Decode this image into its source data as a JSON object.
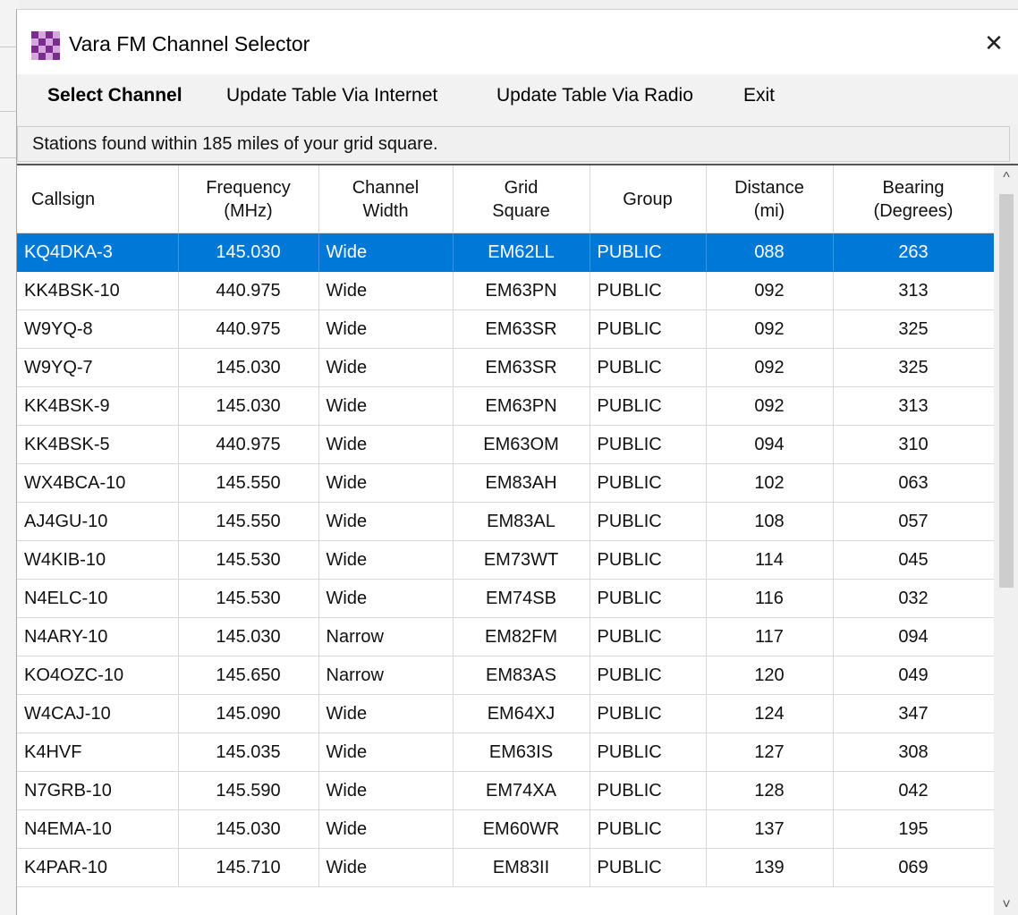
{
  "window": {
    "title": "Vara FM Channel Selector",
    "close_glyph": "✕"
  },
  "menu": {
    "select_channel": "Select Channel",
    "update_internet": "Update Table Via Internet",
    "update_radio": "Update Table Via Radio",
    "exit": "Exit"
  },
  "status": {
    "text": "Stations found within 185 miles of your grid square."
  },
  "table": {
    "headers": {
      "callsign": "Callsign",
      "frequency_1": "Frequency",
      "frequency_2": "(MHz)",
      "width_1": "Channel",
      "width_2": "Width",
      "grid_1": "Grid",
      "grid_2": "Square",
      "group": "Group",
      "distance_1": "Distance",
      "distance_2": "(mi)",
      "bearing_1": "Bearing",
      "bearing_2": "(Degrees)"
    },
    "rows": [
      [
        "KQ4DKA-3",
        "145.030",
        "Wide",
        "EM62LL",
        "PUBLIC",
        "088",
        "263"
      ],
      [
        "KK4BSK-10",
        "440.975",
        "Wide",
        "EM63PN",
        "PUBLIC",
        "092",
        "313"
      ],
      [
        "W9YQ-8",
        "440.975",
        "Wide",
        "EM63SR",
        "PUBLIC",
        "092",
        "325"
      ],
      [
        "W9YQ-7",
        "145.030",
        "Wide",
        "EM63SR",
        "PUBLIC",
        "092",
        "325"
      ],
      [
        "KK4BSK-9",
        "145.030",
        "Wide",
        "EM63PN",
        "PUBLIC",
        "092",
        "313"
      ],
      [
        "KK4BSK-5",
        "440.975",
        "Wide",
        "EM63OM",
        "PUBLIC",
        "094",
        "310"
      ],
      [
        "WX4BCA-10",
        "145.550",
        "Wide",
        "EM83AH",
        "PUBLIC",
        "102",
        "063"
      ],
      [
        "AJ4GU-10",
        "145.550",
        "Wide",
        "EM83AL",
        "PUBLIC",
        "108",
        "057"
      ],
      [
        "W4KIB-10",
        "145.530",
        "Wide",
        "EM73WT",
        "PUBLIC",
        "114",
        "045"
      ],
      [
        "N4ELC-10",
        "145.530",
        "Wide",
        "EM74SB",
        "PUBLIC",
        "116",
        "032"
      ],
      [
        "N4ARY-10",
        "145.030",
        "Narrow",
        "EM82FM",
        "PUBLIC",
        "117",
        "094"
      ],
      [
        "KO4OZC-10",
        "145.650",
        "Narrow",
        "EM83AS",
        "PUBLIC",
        "120",
        "049"
      ],
      [
        "W4CAJ-10",
        "145.090",
        "Wide",
        "EM64XJ",
        "PUBLIC",
        "124",
        "347"
      ],
      [
        "K4HVF",
        "145.035",
        "Wide",
        "EM63IS",
        "PUBLIC",
        "127",
        "308"
      ],
      [
        "N7GRB-10",
        "145.590",
        "Wide",
        "EM74XA",
        "PUBLIC",
        "128",
        "042"
      ],
      [
        "N4EMA-10",
        "145.030",
        "Wide",
        "EM60WR",
        "PUBLIC",
        "137",
        "195"
      ],
      [
        "K4PAR-10",
        "145.710",
        "Wide",
        "EM83II",
        "PUBLIC",
        "139",
        "069"
      ]
    ]
  },
  "scrollbar": {
    "up_glyph": "^",
    "down_glyph": "˅"
  },
  "colors": {
    "selection": "#0078d7"
  }
}
